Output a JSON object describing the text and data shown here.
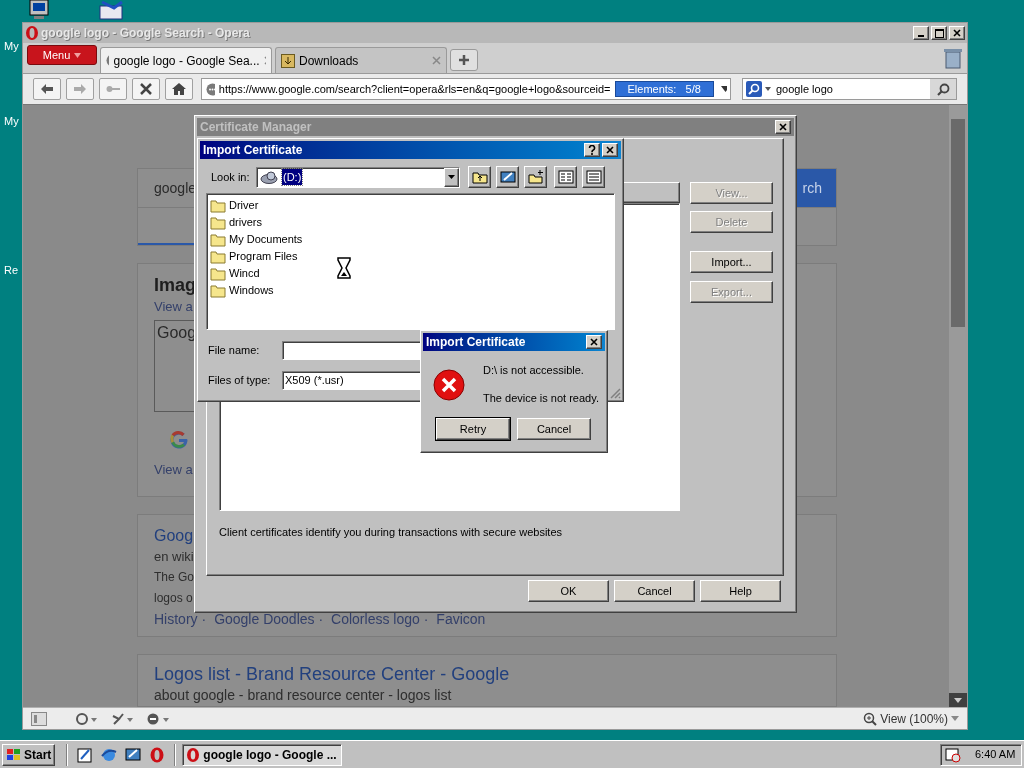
{
  "desktop": {
    "icon_labels": [
      "My",
      "My",
      "Re"
    ]
  },
  "browser": {
    "title": "google logo - Google Search - Opera",
    "menu_label": "Menu",
    "tabs": [
      {
        "label": "google logo - Google Sea...",
        "selected": true
      },
      {
        "label": "Downloads",
        "selected": false
      }
    ],
    "address": "https://www.google.com/search?client=opera&rls=en&q=google+logo&sourceid=",
    "address_badge": "Elements:   5/8",
    "search_value": "google logo",
    "page": {
      "search_text": "google",
      "search_button": "rch",
      "images_heading": "Imag",
      "images_link": "View a",
      "image_box_text": "Goog",
      "view_all": "View a",
      "result1": {
        "title": "Goog",
        "url": "en wiki",
        "snippet": [
          "The Go",
          "logos o"
        ],
        "links": [
          "History ·",
          "Google Doodles ·",
          "Colorless logo ·",
          "Favicon"
        ]
      },
      "result2": {
        "title": "Logos list - Brand Resource Center - Google",
        "url": "about google - brand resource center - logos list"
      }
    },
    "zoom_label": "View (100%)"
  },
  "cert_manager": {
    "title": "Certificate Manager",
    "side_buttons": [
      {
        "label": "View...",
        "disabled": true
      },
      {
        "label": "Delete",
        "disabled": true
      },
      {
        "label": "Import...",
        "disabled": false
      },
      {
        "label": "Export...",
        "disabled": true
      }
    ],
    "description": "Client certificates identify you during transactions with secure websites",
    "footer_buttons": [
      "OK",
      "Cancel",
      "Help"
    ]
  },
  "file_dialog": {
    "title": "Import Certificate",
    "look_in_label": "Look in:",
    "look_in_value": "(D:)",
    "files": [
      "Driver",
      "drivers",
      "My Documents",
      "Program Files",
      "Wincd",
      "Windows"
    ],
    "file_name_label": "File name:",
    "file_type_label": "Files of type:",
    "file_type_value": "X509 (*.usr)"
  },
  "error_dialog": {
    "title": "Import Certificate",
    "messages": [
      "D:\\ is not accessible.",
      "The device is not ready."
    ],
    "buttons": [
      {
        "label": "Retry",
        "default": true
      },
      {
        "label": "Cancel",
        "default": false
      }
    ]
  },
  "taskbar": {
    "start": "Start",
    "task": "google logo - Google ...",
    "clock": "6:40 AM"
  }
}
